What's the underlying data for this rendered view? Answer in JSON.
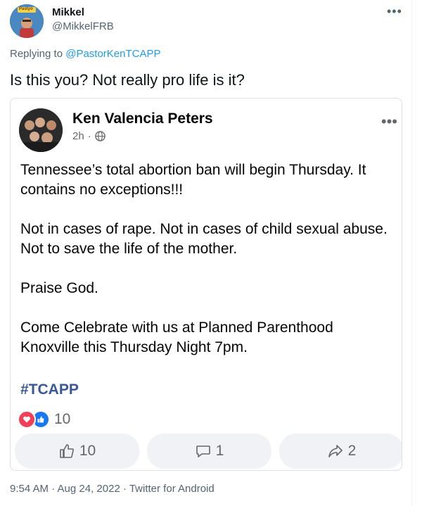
{
  "tweet": {
    "author_name": "Mikkel",
    "author_handle": "@MikkelFRB",
    "avatar_text": "Pastyo",
    "replying_to_label": "Replying to",
    "replying_to_handle": "@PastorKenTCAPP",
    "text": "Is this you? Not really pro life is it?",
    "more_icon": "•••",
    "footer": "9:54 AM · Aug 24, 2022 · Twitter for Android"
  },
  "facebook_post": {
    "author_name": "Ken Valencia Peters",
    "time": "2h",
    "separator": "·",
    "audience_icon": "globe-icon",
    "more_icon": "•••",
    "paragraphs": [
      "Tennessee’s total abortion ban will begin Thursday. It contains no exceptions!!!",
      "Not in cases of rape. Not in cases of child sexual abuse. Not to save the life of the mother.",
      "Praise God.",
      "Come Celebrate with us at Planned Parenthood Knoxville this Thursday Night 7pm."
    ],
    "hashtag": "#TCAPP",
    "reaction_count": "10",
    "actions": {
      "like_count": "10",
      "comment_count": "1",
      "share_count": "2"
    }
  },
  "colors": {
    "twitter_blue": "#1d9bf0",
    "twitter_gray": "#536471",
    "fb_button_bg": "#f0f2f5",
    "fb_hashtag": "#385898",
    "love_red": "#f33e58",
    "like_blue": "#1877f2"
  }
}
